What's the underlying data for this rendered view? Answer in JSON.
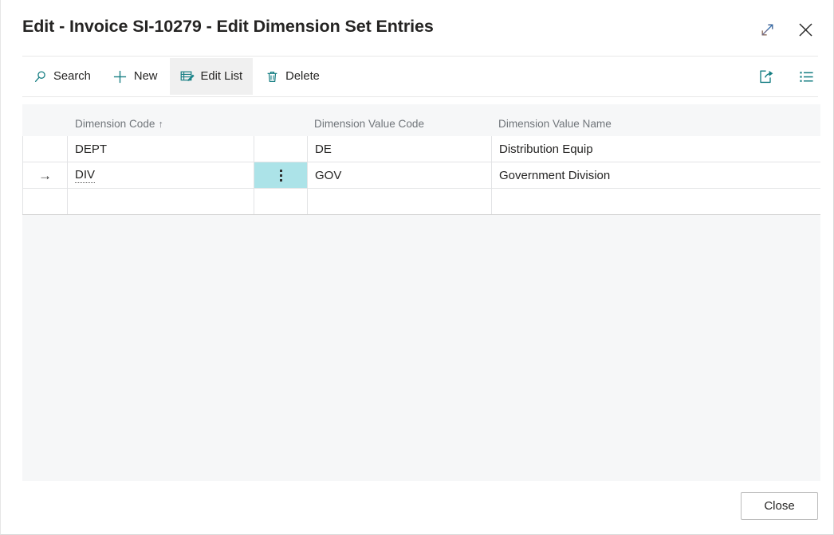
{
  "window": {
    "title": "Edit - Invoice SI-10279 - Edit Dimension Set Entries",
    "expand_label": "expand-icon",
    "close_label": "close-icon"
  },
  "toolbar": {
    "search_label": "Search",
    "new_label": "New",
    "edit_list_label": "Edit List",
    "delete_label": "Delete",
    "share_icon_name": "share-icon",
    "view_options_icon_name": "list-view-icon"
  },
  "grid": {
    "columns": [
      {
        "key": "indicator",
        "label": ""
      },
      {
        "key": "dimension_code",
        "label": "Dimension Code",
        "sort": "↑"
      },
      {
        "key": "actions",
        "label": ""
      },
      {
        "key": "dimension_value_code",
        "label": "Dimension Value Code"
      },
      {
        "key": "dimension_value_name",
        "label": "Dimension Value Name"
      }
    ],
    "rows": [
      {
        "indicator": "",
        "dimension_code": "DEPT",
        "actions": "",
        "dimension_value_code": "DE",
        "dimension_value_name": "Distribution Equip",
        "selected": false,
        "current": false
      },
      {
        "indicator": "→",
        "dimension_code": "DIV",
        "actions": "⋮",
        "dimension_value_code": "GOV",
        "dimension_value_name": "Government Division",
        "selected": true,
        "current": true
      },
      {
        "indicator": "",
        "dimension_code": "",
        "actions": "",
        "dimension_value_code": "",
        "dimension_value_name": "",
        "selected": false,
        "current": false
      }
    ]
  },
  "footer": {
    "close_label": "Close"
  },
  "colors": {
    "accent": "#147D82",
    "selection": "#ACE3E8",
    "panel_background": "#F6F7F8",
    "toolbar_active": "#F0F0F0",
    "header_text": "#70757A",
    "body_text": "#252423"
  }
}
